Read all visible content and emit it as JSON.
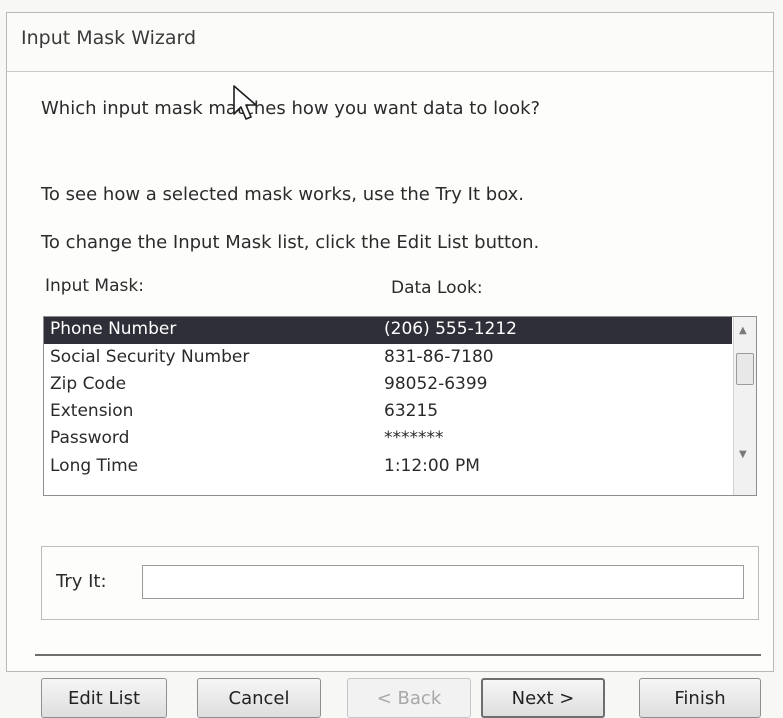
{
  "window": {
    "title": "Input Mask Wizard"
  },
  "prompt": {
    "question": "Which input mask matches how you want data to look?",
    "hint_try": "To see how a selected mask works, use the Try It box.",
    "hint_edit": "To change the Input Mask list, click the Edit List button."
  },
  "list": {
    "col_mask": "Input Mask:",
    "col_look": "Data Look:",
    "rows": [
      {
        "mask": "Phone Number",
        "look": "(206) 555-1212"
      },
      {
        "mask": "Social Security Number",
        "look": "831-86-7180"
      },
      {
        "mask": "Zip Code",
        "look": "98052-6399"
      },
      {
        "mask": "Extension",
        "look": "63215"
      },
      {
        "mask": "Password",
        "look": "*******"
      },
      {
        "mask": "Long Time",
        "look": "1:12:00 PM"
      }
    ],
    "selected_row": "Phone Number"
  },
  "tryit": {
    "label": "Try It:",
    "value": ""
  },
  "buttons": {
    "edit_list": "Edit List",
    "cancel": "Cancel",
    "back": "< Back",
    "next": "Next >",
    "finish": "Finish"
  },
  "icons": {
    "scroll_up": "scroll-up-arrow-icon",
    "scroll_down": "scroll-down-arrow-icon",
    "cursor": "mouse-pointer-icon"
  }
}
